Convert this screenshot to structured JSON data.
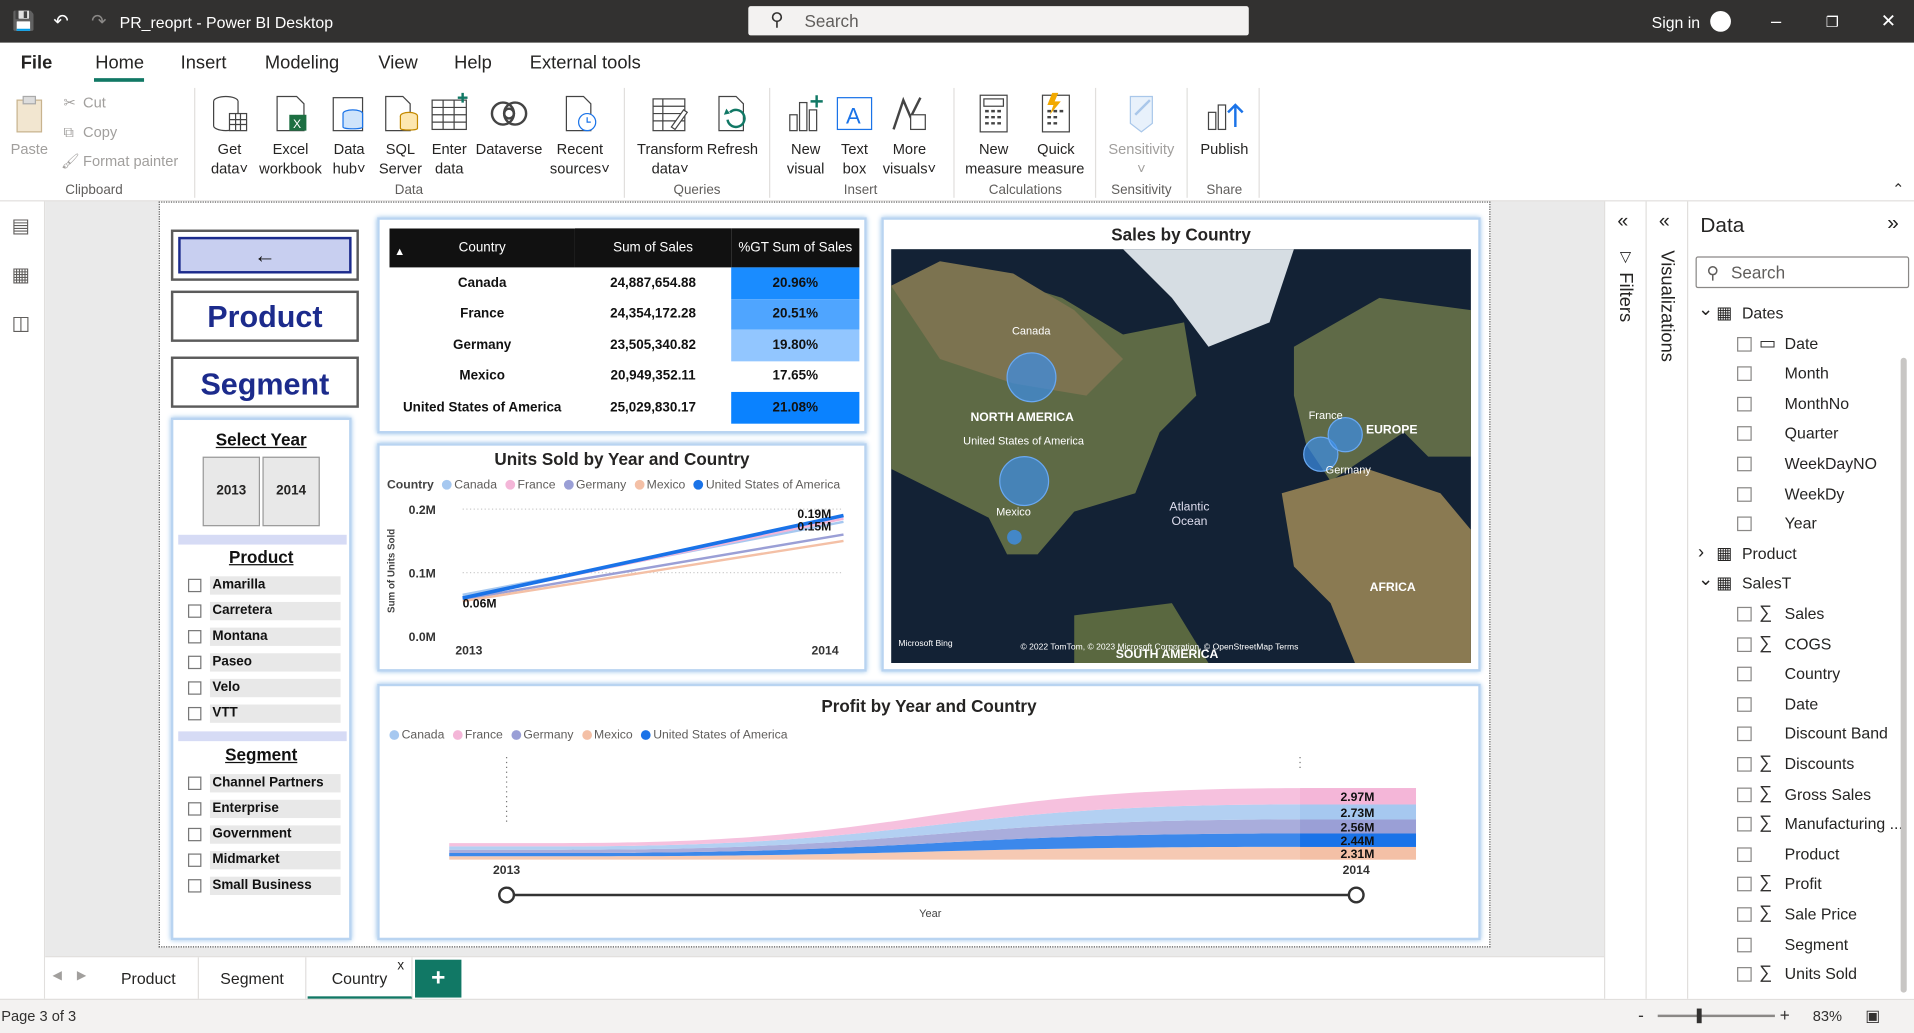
{
  "titlebar": {
    "title": "PR_reoprt - Power BI Desktop",
    "search_placeholder": "Search",
    "sign_in": "Sign in"
  },
  "menu": {
    "tabs": [
      "File",
      "Home",
      "Insert",
      "Modeling",
      "View",
      "Help",
      "External tools"
    ],
    "active": "Home"
  },
  "ribbon": {
    "clipboard": {
      "paste": "Paste",
      "cut": "Cut",
      "copy": "Copy",
      "format_painter": "Format painter",
      "group": "Clipboard"
    },
    "data": {
      "get_data": [
        "Get",
        "data"
      ],
      "excel": [
        "Excel",
        "workbook"
      ],
      "data_hub": [
        "Data",
        "hub"
      ],
      "sql": [
        "SQL",
        "Server"
      ],
      "enter": [
        "Enter",
        "data"
      ],
      "dataverse": "Dataverse",
      "recent": [
        "Recent",
        "sources"
      ],
      "group": "Data"
    },
    "queries": {
      "transform": [
        "Transform",
        "data"
      ],
      "refresh": "Refresh",
      "group": "Queries"
    },
    "insert": {
      "new_visual": [
        "New",
        "visual"
      ],
      "text_box": [
        "Text",
        "box"
      ],
      "more_visuals": [
        "More",
        "visuals"
      ],
      "group": "Insert"
    },
    "calculations": {
      "new_measure": [
        "New",
        "measure"
      ],
      "quick_measure": [
        "Quick",
        "measure"
      ],
      "group": "Calculations"
    },
    "sensitivity": {
      "label": "Sensitivity",
      "group": "Sensitivity"
    },
    "share": {
      "publish": "Publish",
      "group": "Share"
    }
  },
  "report": {
    "nav_buttons": {
      "product": "Product",
      "segment": "Segment"
    },
    "year_slicer": {
      "title": "Select Year",
      "years": [
        "2013",
        "2014"
      ]
    },
    "product_slicer": {
      "title": "Product",
      "items": [
        "Amarilla",
        "Carretera",
        "Montana",
        "Paseo",
        "Velo",
        "VTT"
      ]
    },
    "segment_slicer": {
      "title": "Segment",
      "items": [
        "Channel Partners",
        "Enterprise",
        "Government",
        "Midmarket",
        "Small Business"
      ]
    },
    "table": {
      "headers": [
        "Country",
        "Sum of Sales",
        "%GT Sum of Sales"
      ],
      "rows": [
        [
          "Canada",
          "24,887,654.88",
          "20.96%"
        ],
        [
          "France",
          "24,354,172.28",
          "20.51%"
        ],
        [
          "Germany",
          "23,505,340.82",
          "19.80%"
        ],
        [
          "Mexico",
          "20,949,352.11",
          "17.65%"
        ],
        [
          "United States of America",
          "25,029,830.17",
          "21.08%"
        ]
      ]
    },
    "map": {
      "title": "Sales by Country",
      "labels": {
        "canada": "Canada",
        "north_america": "NORTH AMERICA",
        "usa": "United States of America",
        "mexico": "Mexico",
        "atlantic": "Atlantic\nOcean",
        "france": "France",
        "europe": "EUROPE",
        "germany": "Germany",
        "africa": "AFRICA",
        "south_america": "SOUTH AMERICA"
      },
      "attribution": "© 2022 TomTom, © 2023 Microsoft Corporation, © OpenStreetMap Terms",
      "brand": "Microsoft Bing"
    },
    "legend_label": "Country",
    "series_colors": {
      "Canada": "#a6c8f0",
      "France": "#f4b6d8",
      "Germany": "#9a9fd6",
      "Mexico": "#f4c0a6",
      "United States of America": "#1a73e8"
    }
  },
  "chart_data": [
    {
      "type": "line",
      "title": "Units Sold by Year and Country",
      "xlabel": "",
      "ylabel": "Sum of Units Sold",
      "x": [
        "2013",
        "2014"
      ],
      "ylim": [
        0,
        0.2
      ],
      "yticks": [
        "0.0M",
        "0.1M",
        "0.2M"
      ],
      "legend_title": "Country",
      "series": [
        {
          "name": "Canada",
          "values": [
            0.065,
            0.18
          ]
        },
        {
          "name": "France",
          "values": [
            0.06,
            0.185
          ]
        },
        {
          "name": "Germany",
          "values": [
            0.058,
            0.16
          ]
        },
        {
          "name": "Mexico",
          "values": [
            0.055,
            0.15
          ]
        },
        {
          "name": "United States of America",
          "values": [
            0.06,
            0.19
          ]
        }
      ],
      "data_labels": [
        "0.06M",
        "0.19M",
        "0.15M"
      ]
    },
    {
      "type": "area",
      "title": "Profit by Year and Country",
      "xlabel": "Year",
      "x": [
        "2013",
        "2014"
      ],
      "series": [
        {
          "name": "Canada",
          "values": [
            0.6,
            2.73
          ]
        },
        {
          "name": "France",
          "values": [
            0.6,
            2.97
          ]
        },
        {
          "name": "Germany",
          "values": [
            0.6,
            2.56
          ]
        },
        {
          "name": "Mexico",
          "values": [
            0.6,
            2.31
          ]
        },
        {
          "name": "United States of America",
          "values": [
            0.6,
            2.44
          ]
        }
      ],
      "data_labels": [
        "2.97M",
        "2.73M",
        "2.56M",
        "2.44M",
        "2.31M"
      ]
    }
  ],
  "page_tabs": [
    "Product",
    "Segment",
    "Country"
  ],
  "active_page": "Country",
  "status": {
    "page": "Page 3 of 3",
    "zoom": "83%"
  },
  "panes": {
    "filters": "Filters",
    "visualizations": "Visualizations",
    "data": "Data",
    "search_placeholder": "Search"
  },
  "fields": {
    "tables": [
      {
        "name": "Dates",
        "expanded": true,
        "fields": [
          {
            "name": "Date",
            "icon": "calendar"
          },
          {
            "name": "Month"
          },
          {
            "name": "MonthNo"
          },
          {
            "name": "Quarter"
          },
          {
            "name": "WeekDayNO"
          },
          {
            "name": "WeekDy"
          },
          {
            "name": "Year"
          }
        ]
      },
      {
        "name": "Product",
        "expanded": false,
        "fields": []
      },
      {
        "name": "SalesT",
        "expanded": true,
        "fields": [
          {
            "name": "Sales",
            "sigma": true
          },
          {
            "name": "COGS",
            "sigma": true
          },
          {
            "name": "Country"
          },
          {
            "name": "Date"
          },
          {
            "name": "Discount Band"
          },
          {
            "name": "Discounts",
            "sigma": true
          },
          {
            "name": "Gross Sales",
            "sigma": true
          },
          {
            "name": "Manufacturing ...",
            "sigma": true
          },
          {
            "name": "Product"
          },
          {
            "name": "Profit",
            "sigma": true
          },
          {
            "name": "Sale Price",
            "sigma": true
          },
          {
            "name": "Segment"
          },
          {
            "name": "Units Sold",
            "sigma": true
          }
        ]
      }
    ]
  }
}
